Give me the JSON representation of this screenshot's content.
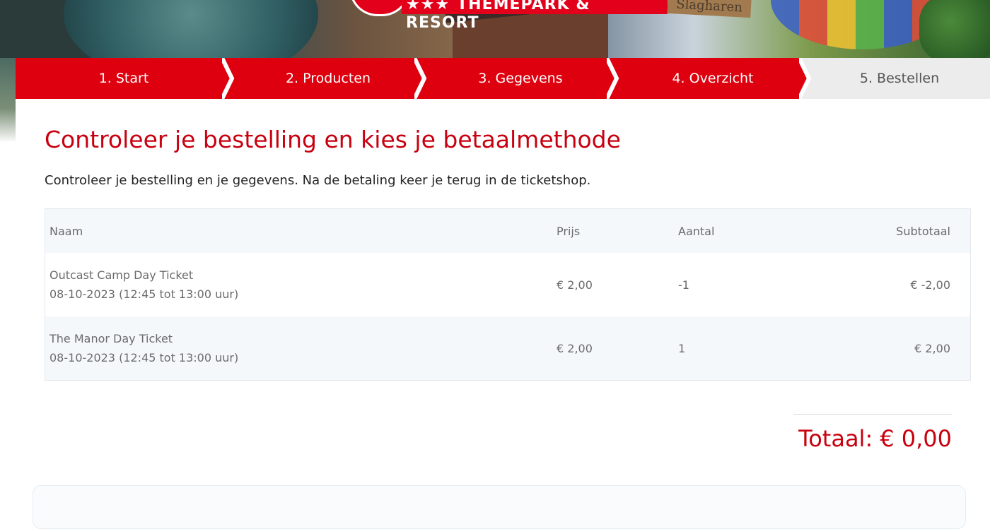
{
  "header": {
    "logo_text": "THEMEPARK & RESORT",
    "logo_stars": "★★★",
    "sign_text": "Slagharen"
  },
  "steps": [
    {
      "label": "1. Start",
      "state": "done"
    },
    {
      "label": "2. Producten",
      "state": "done"
    },
    {
      "label": "3. Gegevens",
      "state": "done"
    },
    {
      "label": "4. Overzicht",
      "state": "current"
    },
    {
      "label": "5. Bestellen",
      "state": "upcoming"
    }
  ],
  "page": {
    "title": "Controleer je bestelling en kies je betaalmethode",
    "intro": "Controleer je bestelling en je gegevens. Na de betaling keer je terug in de ticketshop."
  },
  "table": {
    "headers": {
      "name": "Naam",
      "price": "Prijs",
      "qty": "Aantal",
      "subtotal": "Subtotaal"
    },
    "rows": [
      {
        "name": "Outcast Camp Day Ticket",
        "date": "08-10-2023 (12:45 tot 13:00 uur)",
        "price": "€ 2,00",
        "qty": "-1",
        "subtotal": "€ -2,00"
      },
      {
        "name": "The Manor Day Ticket",
        "date": "08-10-2023 (12:45 tot 13:00 uur)",
        "price": "€ 2,00",
        "qty": "1",
        "subtotal": "€ 2,00"
      }
    ]
  },
  "total": {
    "label": "Totaal:",
    "value": "€ 0,00"
  },
  "colors": {
    "brand_red": "#de000e",
    "title_red": "#c8000f",
    "step_inactive": "#ececec"
  }
}
